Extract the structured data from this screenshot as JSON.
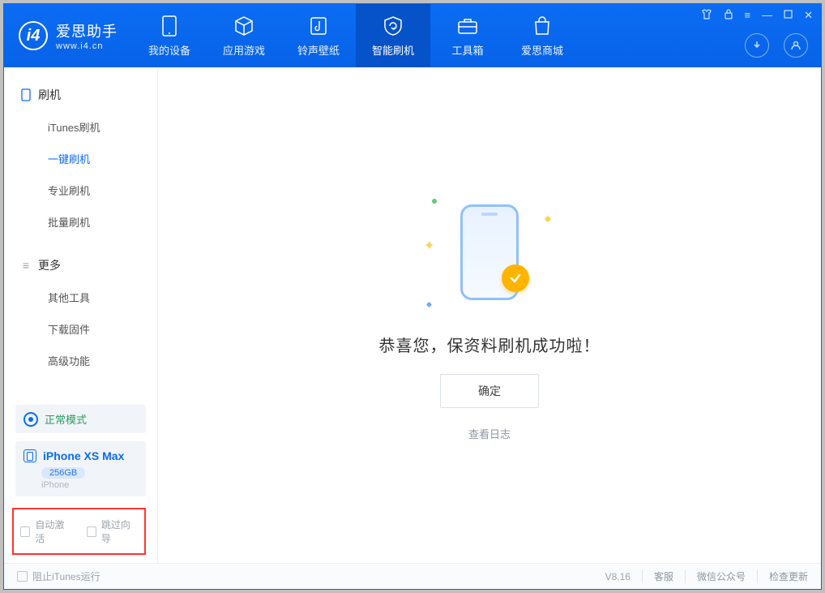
{
  "brand": {
    "name": "爱思助手",
    "site": "www.i4.cn"
  },
  "nav": {
    "items": [
      {
        "label": "我的设备"
      },
      {
        "label": "应用游戏"
      },
      {
        "label": "铃声壁纸"
      },
      {
        "label": "智能刷机"
      },
      {
        "label": "工具箱"
      },
      {
        "label": "爱思商城"
      }
    ]
  },
  "sidebar": {
    "group1": {
      "label": "刷机",
      "items": [
        "iTunes刷机",
        "一键刷机",
        "专业刷机",
        "批量刷机"
      ]
    },
    "group2": {
      "label": "更多",
      "items": [
        "其他工具",
        "下载固件",
        "高级功能"
      ]
    }
  },
  "device": {
    "mode": "正常模式",
    "name": "iPhone XS Max",
    "capacity": "256GB",
    "type": "iPhone"
  },
  "options": {
    "auto_activate": "自动激活",
    "skip_guide": "跳过向导"
  },
  "main": {
    "title": "恭喜您，保资料刷机成功啦！",
    "ok": "确定",
    "view_log": "查看日志"
  },
  "footer": {
    "block_itunes": "阻止iTunes运行",
    "version": "V8.16",
    "links": [
      "客服",
      "微信公众号",
      "检查更新"
    ]
  }
}
